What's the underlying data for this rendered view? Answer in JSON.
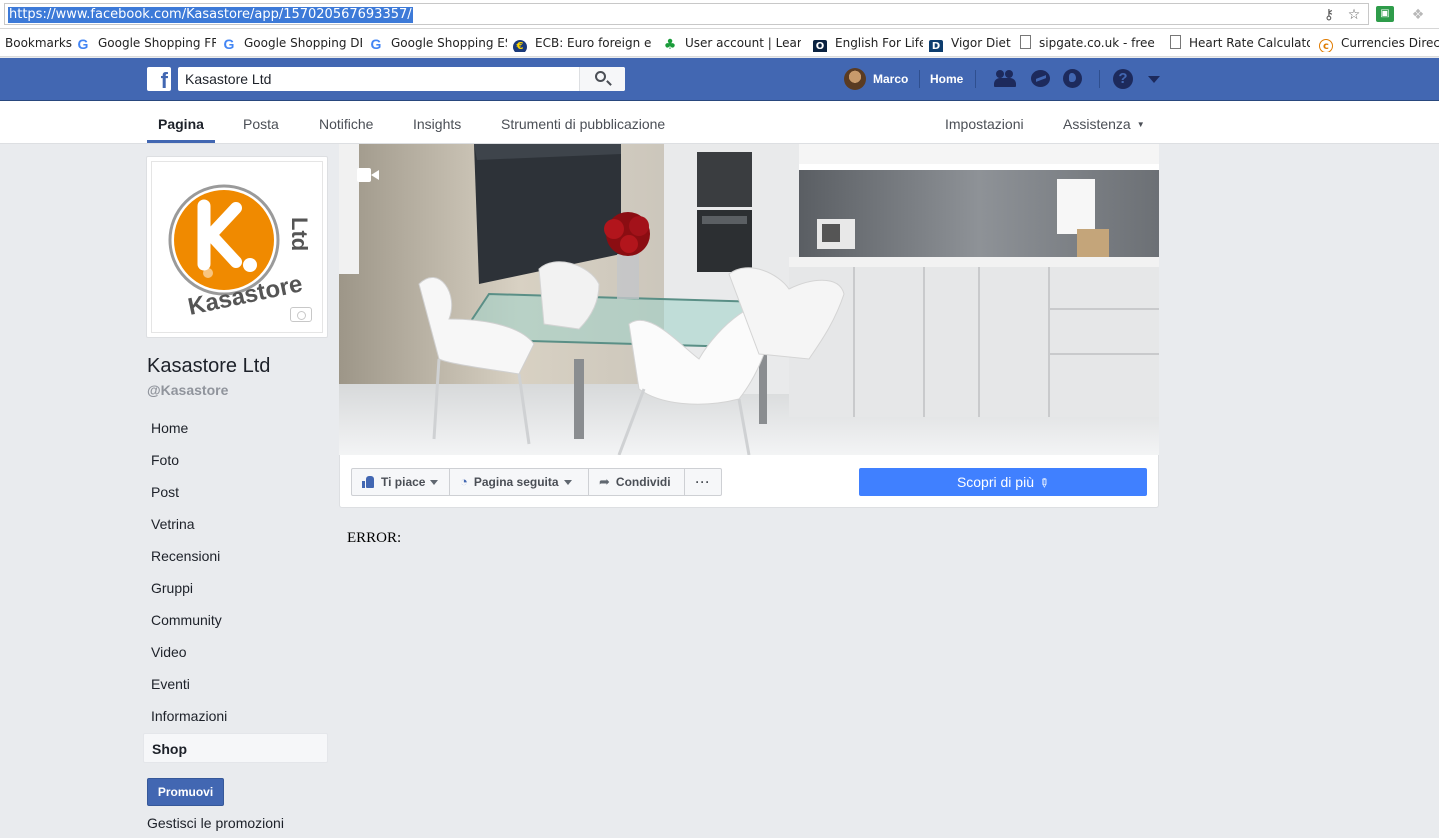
{
  "browser": {
    "url": "https://www.facebook.com/Kasastore/app/157020567693357/",
    "bookmarks": [
      {
        "label": "Bookmarks",
        "icon": "none"
      },
      {
        "label": "Google Shopping FR",
        "icon": "google-icon"
      },
      {
        "label": "Google Shopping DE",
        "icon": "google-icon"
      },
      {
        "label": "Google Shopping ES",
        "icon": "google-icon"
      },
      {
        "label": "ECB: Euro foreign exc",
        "icon": "ecb-icon"
      },
      {
        "label": "User account | LearnE",
        "icon": "clover-icon"
      },
      {
        "label": "English For Life",
        "icon": "o-icon"
      },
      {
        "label": "Vigor Diet",
        "icon": "d-icon"
      },
      {
        "label": "sipgate.co.uk - free p",
        "icon": "page-icon"
      },
      {
        "label": "Heart Rate Calculator",
        "icon": "page-icon"
      },
      {
        "label": "Currencies Direct C",
        "icon": "currency-icon"
      }
    ]
  },
  "header": {
    "search_value": "Kasastore Ltd",
    "user_name": "Marco",
    "home_label": "Home"
  },
  "page_nav": {
    "items": [
      "Pagina",
      "Posta",
      "Notifiche",
      "Insights",
      "Strumenti di pubblicazione"
    ],
    "settings_label": "Impostazioni",
    "help_label": "Assistenza"
  },
  "page": {
    "name": "Kasastore Ltd",
    "handle": "@Kasastore",
    "logo_letter": "K.",
    "logo_text": "Kasastore Ltd",
    "logo_color": "#f08a00"
  },
  "sidebar": {
    "items": [
      "Home",
      "Foto",
      "Post",
      "Vetrina",
      "Recensioni",
      "Gruppi",
      "Community",
      "Video",
      "Eventi",
      "Informazioni"
    ],
    "active_item": "Shop",
    "promote_label": "Promuovi",
    "manage_promotions_label": "Gestisci le promozioni"
  },
  "actions": {
    "like_label": "Ti piace",
    "follow_label": "Pagina seguita",
    "share_label": "Condividi",
    "more_label": "···",
    "cta_label": "Scopri di più"
  },
  "content": {
    "error_text": "ERROR:"
  },
  "colors": {
    "fb_blue": "#4267b2",
    "cta_blue": "#4080ff",
    "background": "#e9ebee"
  }
}
